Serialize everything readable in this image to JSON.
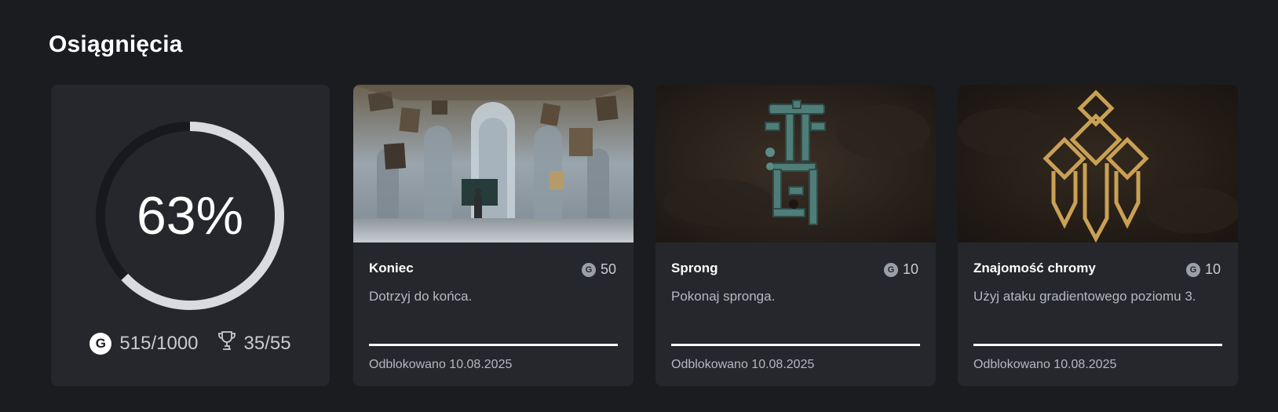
{
  "section": {
    "title": "Osiągnięcia"
  },
  "summary": {
    "percent_label": "63%",
    "percent": 63,
    "gamerscore_icon": "G",
    "gamerscore": "515/1000",
    "trophy_icon": "trophy-icon",
    "achievements": "35/55"
  },
  "achievements": [
    {
      "name": "Koniec",
      "points_icon": "G",
      "points": "50",
      "description": "Dotrzyj do końca.",
      "progress": 1.0,
      "unlocked": "Odblokowano 10.08.2025",
      "image": "art-gallery-rotunda"
    },
    {
      "name": "Sprong",
      "points_icon": "G",
      "points": "10",
      "description": "Pokonaj spronga.",
      "progress": 1.0,
      "unlocked": "Odblokowano 10.08.2025",
      "image": "verdigris-glyph"
    },
    {
      "name": "Znajomość chromy",
      "points_icon": "G",
      "points": "10",
      "description": "Użyj ataku gradientowego poziomu 3.",
      "progress": 1.0,
      "unlocked": "Odblokowano 10.08.2025",
      "image": "gold-crystal-crest"
    }
  ],
  "colors": {
    "background": "#1b1c20",
    "card": "#25272c",
    "ring_track": "#18191d",
    "ring_fill": "#d9dbe0",
    "progress": "#ffffff"
  }
}
